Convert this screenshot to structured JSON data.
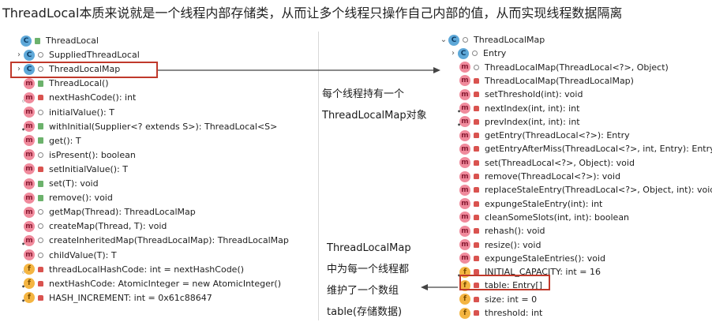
{
  "headline": "ThreadLocal本质来说就是一个线程内部存储类，从而让多个线程只操作自己内部的值，从而实现线程数据隔离",
  "left": {
    "items": [
      {
        "arrow": "",
        "icon": "C",
        "kind": "c",
        "pin": "",
        "vis": "pub",
        "text": "ThreadLocal"
      },
      {
        "arrow": ">",
        "icon": "C",
        "kind": "c",
        "pin": "",
        "vis": "pkg",
        "text": "SuppliedThreadLocal"
      },
      {
        "arrow": ">",
        "icon": "C",
        "kind": "c",
        "pin": "",
        "vis": "pkg",
        "text": "ThreadLocalMap"
      },
      {
        "arrow": "",
        "icon": "m",
        "kind": "m",
        "pin": "",
        "vis": "pub",
        "text": "ThreadLocal()"
      },
      {
        "arrow": "",
        "icon": "m",
        "kind": "m",
        "pin": "f",
        "vis": "prv",
        "text": "nextHashCode(): int"
      },
      {
        "arrow": "",
        "icon": "m",
        "kind": "m",
        "pin": "",
        "vis": "pkg",
        "text": "initialValue(): T"
      },
      {
        "arrow": "",
        "icon": "m",
        "kind": "m",
        "pin": "s",
        "vis": "pub",
        "text": "withInitial(Supplier<? extends S>): ThreadLocal<S>"
      },
      {
        "arrow": "",
        "icon": "m",
        "kind": "m",
        "pin": "",
        "vis": "pub",
        "text": "get(): T"
      },
      {
        "arrow": "",
        "icon": "m",
        "kind": "m",
        "pin": "",
        "vis": "pkg",
        "text": "isPresent(): boolean"
      },
      {
        "arrow": "",
        "icon": "m",
        "kind": "m",
        "pin": "",
        "vis": "prv",
        "text": "setInitialValue(): T"
      },
      {
        "arrow": "",
        "icon": "m",
        "kind": "m",
        "pin": "",
        "vis": "pub",
        "text": "set(T): void"
      },
      {
        "arrow": "",
        "icon": "m",
        "kind": "m",
        "pin": "",
        "vis": "pub",
        "text": "remove(): void"
      },
      {
        "arrow": "",
        "icon": "m",
        "kind": "m",
        "pin": "",
        "vis": "pkg",
        "text": "getMap(Thread): ThreadLocalMap"
      },
      {
        "arrow": "",
        "icon": "m",
        "kind": "m",
        "pin": "",
        "vis": "pkg",
        "text": "createMap(Thread, T): void"
      },
      {
        "arrow": "",
        "icon": "m",
        "kind": "m",
        "pin": "s",
        "vis": "pkg",
        "text": "createInheritedMap(ThreadLocalMap): ThreadLocalMap"
      },
      {
        "arrow": "",
        "icon": "m",
        "kind": "m",
        "pin": "",
        "vis": "pkg",
        "text": "childValue(T): T"
      },
      {
        "arrow": "",
        "icon": "f",
        "kind": "f",
        "pin": "f",
        "vis": "prv",
        "text": "threadLocalHashCode: int = nextHashCode()"
      },
      {
        "arrow": "",
        "icon": "f",
        "kind": "f",
        "pin": "s",
        "vis": "prv",
        "text": "nextHashCode: AtomicInteger = new AtomicInteger()"
      },
      {
        "arrow": "",
        "icon": "f",
        "kind": "f",
        "pin": "s",
        "vis": "prv",
        "text": "HASH_INCREMENT: int = 0x61c88647"
      }
    ]
  },
  "right": {
    "items": [
      {
        "arrow": "v",
        "icon": "C",
        "kind": "c",
        "pin": "",
        "vis": "pkg",
        "text": "ThreadLocalMap"
      },
      {
        "arrow": ">",
        "icon": "C",
        "kind": "c",
        "pin": "",
        "vis": "pkg",
        "text": "Entry"
      },
      {
        "arrow": "",
        "icon": "m",
        "kind": "m",
        "pin": "",
        "vis": "pkg",
        "text": "ThreadLocalMap(ThreadLocal<?>, Object)"
      },
      {
        "arrow": "",
        "icon": "m",
        "kind": "m",
        "pin": "",
        "vis": "prv",
        "text": "ThreadLocalMap(ThreadLocalMap)"
      },
      {
        "arrow": "",
        "icon": "m",
        "kind": "m",
        "pin": "",
        "vis": "prv",
        "text": "setThreshold(int): void"
      },
      {
        "arrow": "",
        "icon": "m",
        "kind": "m",
        "pin": "s",
        "vis": "prv",
        "text": "nextIndex(int, int): int"
      },
      {
        "arrow": "",
        "icon": "m",
        "kind": "m",
        "pin": "s",
        "vis": "prv",
        "text": "prevIndex(int, int): int"
      },
      {
        "arrow": "",
        "icon": "m",
        "kind": "m",
        "pin": "",
        "vis": "prv",
        "text": "getEntry(ThreadLocal<?>): Entry"
      },
      {
        "arrow": "",
        "icon": "m",
        "kind": "m",
        "pin": "",
        "vis": "prv",
        "text": "getEntryAfterMiss(ThreadLocal<?>, int, Entry): Entry"
      },
      {
        "arrow": "",
        "icon": "m",
        "kind": "m",
        "pin": "",
        "vis": "prv",
        "text": "set(ThreadLocal<?>, Object): void"
      },
      {
        "arrow": "",
        "icon": "m",
        "kind": "m",
        "pin": "",
        "vis": "prv",
        "text": "remove(ThreadLocal<?>): void"
      },
      {
        "arrow": "",
        "icon": "m",
        "kind": "m",
        "pin": "",
        "vis": "prv",
        "text": "replaceStaleEntry(ThreadLocal<?>, Object, int): void"
      },
      {
        "arrow": "",
        "icon": "m",
        "kind": "m",
        "pin": "",
        "vis": "prv",
        "text": "expungeStaleEntry(int): int"
      },
      {
        "arrow": "",
        "icon": "m",
        "kind": "m",
        "pin": "",
        "vis": "prv",
        "text": "cleanSomeSlots(int, int): boolean"
      },
      {
        "arrow": "",
        "icon": "m",
        "kind": "m",
        "pin": "",
        "vis": "prv",
        "text": "rehash(): void"
      },
      {
        "arrow": "",
        "icon": "m",
        "kind": "m",
        "pin": "",
        "vis": "prv",
        "text": "resize(): void"
      },
      {
        "arrow": "",
        "icon": "m",
        "kind": "m",
        "pin": "",
        "vis": "prv",
        "text": "expungeStaleEntries(): void"
      },
      {
        "arrow": "",
        "icon": "f",
        "kind": "f",
        "pin": "s",
        "vis": "prv",
        "text": "INITIAL_CAPACITY: int = 16"
      },
      {
        "arrow": "",
        "icon": "f",
        "kind": "f",
        "pin": "",
        "vis": "prv",
        "text": "table: Entry[]"
      },
      {
        "arrow": "",
        "icon": "f",
        "kind": "f",
        "pin": "",
        "vis": "prv",
        "text": "size: int = 0"
      },
      {
        "arrow": "",
        "icon": "f",
        "kind": "f",
        "pin": "",
        "vis": "prv",
        "text": "threshold: int"
      }
    ]
  },
  "note_top": [
    "每个线程持有一个",
    "ThreadLocalMap对象"
  ],
  "note_bottom": [
    "ThreadLocalMap",
    "中为每一个线程都",
    "维护了一个数组",
    "table(存储数据)"
  ],
  "colors": {
    "highlight": "#c0392b",
    "arrow": "#444444"
  }
}
